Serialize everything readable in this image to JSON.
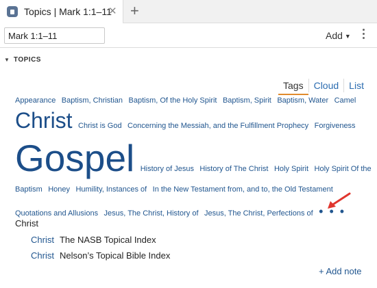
{
  "tab": {
    "title": "Topics | Mark 1:1–11",
    "close_glyph": "✕",
    "new_tab_glyph": "+"
  },
  "toolbar": {
    "reference_value": "Mark 1:1–11",
    "add_label": "Add",
    "add_caret": "▼"
  },
  "section": {
    "caret": "▼",
    "title": "TOPICS"
  },
  "views": {
    "tags": "Tags",
    "cloud": "Cloud",
    "list": "List",
    "active": "Tags"
  },
  "cloud": {
    "line1": [
      "Appearance",
      "Baptism, Christian",
      "Baptism, Of the Holy Spirit",
      "Baptism, Spirit",
      "Baptism, Water",
      "Camel"
    ],
    "line2_big": "Christ",
    "line2": [
      "Christ is God",
      "Concerning the Messiah, and the Fulfillment Prophecy",
      "Forgiveness"
    ],
    "line3_big": "Gospel",
    "line3": [
      "History of Jesus",
      "History of The Christ",
      "Holy Spirit",
      "Holy Spirit Of the"
    ],
    "line4": [
      "Baptism",
      "Honey",
      "Humility, Instances of",
      "In the New Testament from, and to, the Old Testament"
    ],
    "line5": [
      "Quotations and Allusions",
      "Jesus, The Christ, History of",
      "Jesus, The Christ, Perfections of"
    ],
    "more": "• • •"
  },
  "selected_topic": {
    "heading": "Christ",
    "references": [
      {
        "link": "Christ",
        "source": "The NASB Topical Index"
      },
      {
        "link": "Christ",
        "source": "Nelson’s Topical Bible Index"
      }
    ]
  },
  "add_note_label": "+ Add note",
  "colors": {
    "link": "#21568f",
    "active_tab_underline": "#e08a2c",
    "arrow": "#e0362e"
  }
}
